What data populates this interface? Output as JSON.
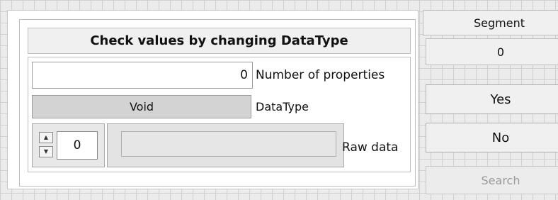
{
  "panel": {
    "title": "Check values by changing DataType",
    "number_of_properties_value": "0",
    "number_of_properties_label": "Number of properties",
    "datatype_value": "Void",
    "datatype_label": "DataType",
    "raw_index_value": "0",
    "raw_data_value": "",
    "raw_data_label": "Raw data"
  },
  "side": {
    "segment_label": "Segment",
    "segment_value": "0",
    "yes_label": "Yes",
    "no_label": "No",
    "search_label": "Search"
  },
  "icons": {
    "increment": "triangle-up",
    "decrement": "triangle-down"
  }
}
